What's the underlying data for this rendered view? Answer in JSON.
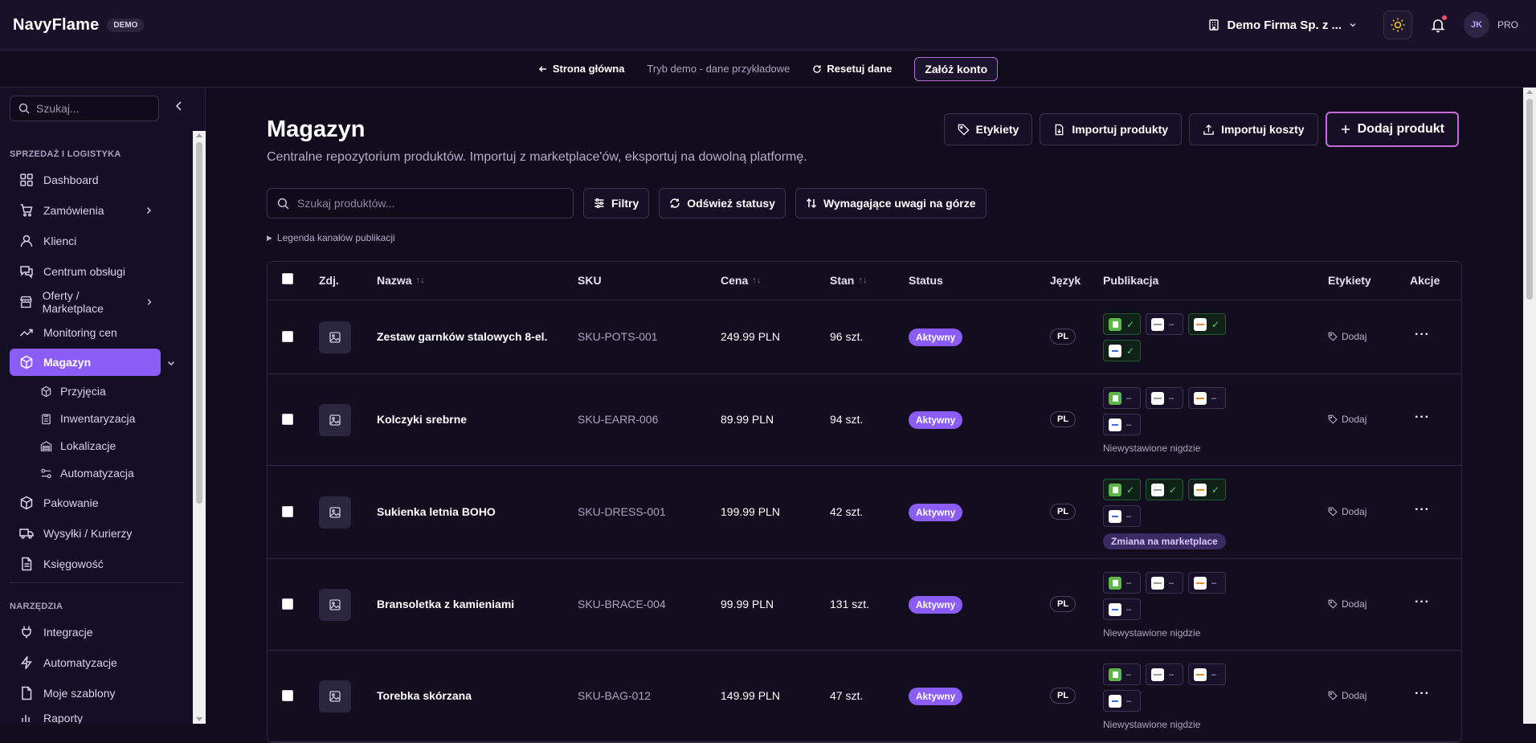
{
  "header": {
    "brand": "NavyFlame",
    "badge": "DEMO",
    "company": "Demo Firma Sp. z ...",
    "user_initials": "JK",
    "user_plan": "PRO"
  },
  "demo_bar": {
    "home": "Strona główna",
    "mode": "Tryb demo - dane przykładowe",
    "reset": "Resetuj dane",
    "signup": "Załóż konto"
  },
  "sidebar": {
    "search_placeholder": "Szukaj...",
    "section_sales": "SPRZEDAŻ I LOGISTYKA",
    "section_tools": "NARZĘDZIA",
    "items": {
      "dashboard": "Dashboard",
      "orders": "Zamówienia",
      "clients": "Klienci",
      "service": "Centrum obsługi",
      "offers": "Oferty / Marketplace",
      "price_monitoring": "Monitoring cen",
      "warehouse": "Magazyn",
      "receipts": "Przyjęcia",
      "inventory": "Inwentaryzacja",
      "locations": "Lokalizacje",
      "automation_sub": "Automatyzacja",
      "packing": "Pakowanie",
      "shipping": "Wysyłki / Kurierzy",
      "accounting": "Księgowość",
      "integrations": "Integracje",
      "automations": "Automatyzacje",
      "templates": "Moje szablony",
      "reports": "Raporty"
    }
  },
  "page": {
    "title": "Magazyn",
    "description": "Centralne repozytorium produktów. Importuj z marketplace'ów, eksportuj na dowolną platformę.",
    "actions": {
      "labels": "Etykiety",
      "import_products": "Importuj produkty",
      "import_costs": "Importuj koszty",
      "add_product": "Dodaj produkt"
    },
    "search_placeholder": "Szukaj produktów...",
    "filters": "Filtry",
    "refresh": "Odśwież statusy",
    "sort_attention": "Wymagające uwagi na górze",
    "legend": "Legenda kanałów publikacji"
  },
  "table": {
    "columns": {
      "photo": "Zdj.",
      "name": "Nazwa",
      "sku": "SKU",
      "price": "Cena",
      "stock": "Stan",
      "status": "Status",
      "language": "Język",
      "publication": "Publikacja",
      "tags": "Etykiety",
      "actions": "Akcje"
    },
    "add_tag": "Dodaj",
    "rows": [
      {
        "name": "Zestaw garnków stalowych 8-el.",
        "sku": "SKU-POTS-001",
        "price": "249.99 PLN",
        "stock": "96 szt.",
        "status": "Aktywny",
        "lang": "PL",
        "channels": [
          "✓",
          "–",
          "✓",
          "✓"
        ],
        "note": "",
        "badge": ""
      },
      {
        "name": "Kolczyki srebrne",
        "sku": "SKU-EARR-006",
        "price": "89.99 PLN",
        "stock": "94 szt.",
        "status": "Aktywny",
        "lang": "PL",
        "channels": [
          "–",
          "–",
          "–",
          "–"
        ],
        "note": "Niewystawione nigdzie",
        "badge": ""
      },
      {
        "name": "Sukienka letnia BOHO",
        "sku": "SKU-DRESS-001",
        "price": "199.99 PLN",
        "stock": "42 szt.",
        "status": "Aktywny",
        "lang": "PL",
        "channels": [
          "✓",
          "✓",
          "✓",
          "–"
        ],
        "note": "",
        "badge": "Zmiana na marketplace"
      },
      {
        "name": "Bransoletka z kamieniami",
        "sku": "SKU-BRACE-004",
        "price": "99.99 PLN",
        "stock": "131 szt.",
        "status": "Aktywny",
        "lang": "PL",
        "channels": [
          "–",
          "–",
          "–",
          "–"
        ],
        "note": "Niewystawione nigdzie",
        "badge": ""
      },
      {
        "name": "Torebka skórzana",
        "sku": "SKU-BAG-012",
        "price": "149.99 PLN",
        "stock": "47 szt.",
        "status": "Aktywny",
        "lang": "PL",
        "channels": [
          "–",
          "–",
          "–",
          "–"
        ],
        "note": "Niewystawione nigdzie",
        "badge": ""
      }
    ]
  },
  "colors": {
    "accent": "#8b5cf6",
    "cta_border": "#c46cd8",
    "success": "#49d36b"
  }
}
